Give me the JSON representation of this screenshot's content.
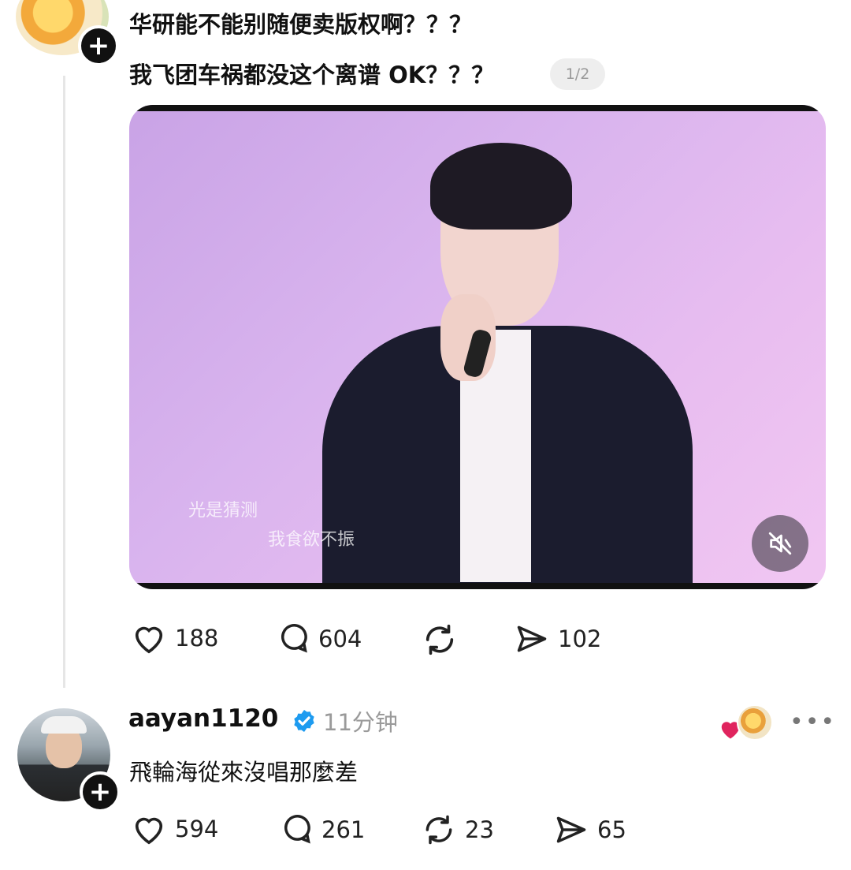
{
  "post": {
    "line1": "华研能不能别随便卖版权啊？？？",
    "line2": "我飞团车祸都没这个离谱 OK？？？",
    "media_counter": "1/2",
    "video": {
      "subtitle1": "光是猜测",
      "subtitle2": "我食欲不振",
      "muted": true
    },
    "actions": {
      "likes": "188",
      "comments": "604",
      "reposts": "",
      "shares": "102"
    }
  },
  "reply": {
    "username": "aayan1120",
    "verified": true,
    "time": "11分钟",
    "text": "飛輪海從來沒唱那麼差",
    "actions": {
      "likes": "594",
      "comments": "261",
      "reposts": "23",
      "shares": "65"
    }
  },
  "colors": {
    "verified_blue": "#1d9bf0",
    "heart_red": "#e0245e",
    "muted_text": "#9a9a9a"
  }
}
